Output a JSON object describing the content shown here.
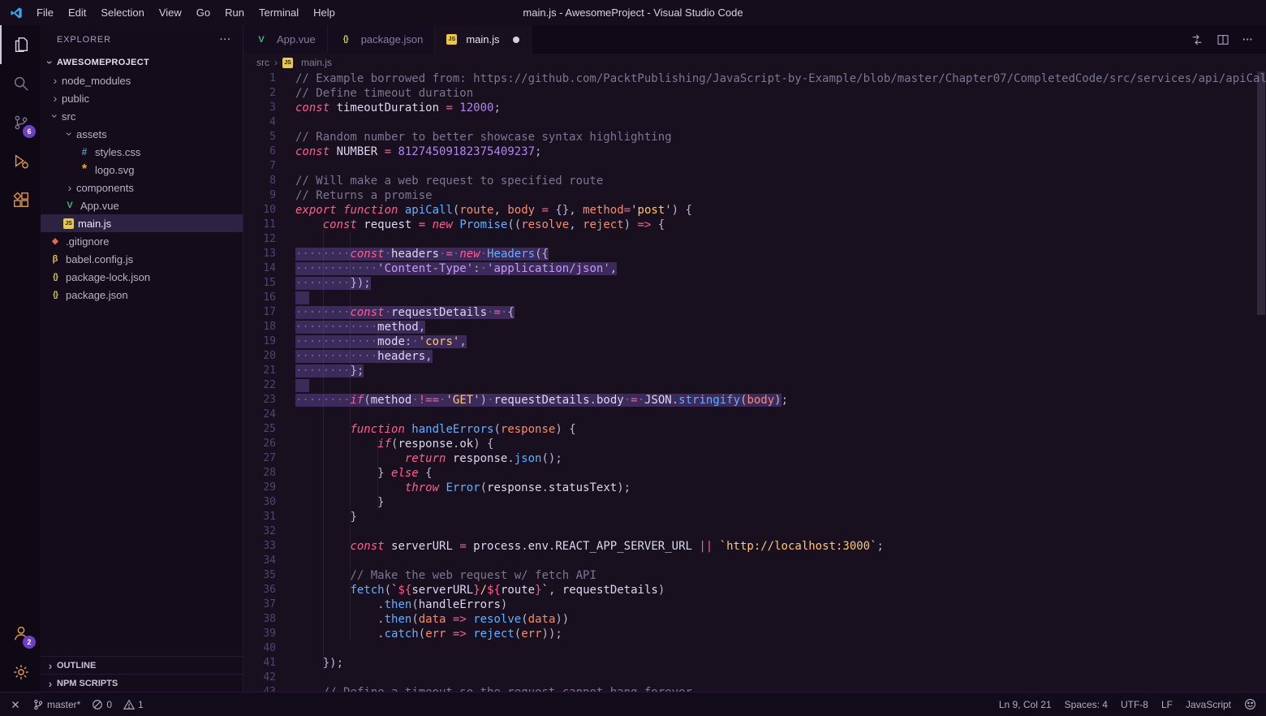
{
  "title_bar": {
    "menus": [
      "File",
      "Edit",
      "Selection",
      "View",
      "Go",
      "Run",
      "Terminal",
      "Help"
    ],
    "title": "main.js - AwesomeProject - Visual Studio Code"
  },
  "activity_bar": {
    "top": [
      {
        "name": "explorer",
        "icon": "files",
        "active": true
      },
      {
        "name": "search",
        "icon": "search"
      },
      {
        "name": "source-control",
        "icon": "scm",
        "badge": "6"
      },
      {
        "name": "run-debug",
        "icon": "debug",
        "amber": true
      },
      {
        "name": "extensions",
        "icon": "extensions",
        "amber": true
      }
    ],
    "bottom": [
      {
        "name": "accounts",
        "icon": "account",
        "badge": "2",
        "amber": true
      },
      {
        "name": "settings",
        "icon": "gear",
        "amber": true
      }
    ]
  },
  "sidebar": {
    "header": "EXPLORER",
    "section": "AWESOMEPROJECT",
    "tree": [
      {
        "label": "node_modules",
        "depth": 0,
        "kind": "folder",
        "expanded": false
      },
      {
        "label": "public",
        "depth": 0,
        "kind": "folder",
        "expanded": false
      },
      {
        "label": "src",
        "depth": 0,
        "kind": "folder",
        "expanded": true
      },
      {
        "label": "assets",
        "depth": 1,
        "kind": "folder",
        "expanded": true
      },
      {
        "label": "styles.css",
        "depth": 2,
        "kind": "file",
        "icon": "css"
      },
      {
        "label": "logo.svg",
        "depth": 2,
        "kind": "file",
        "icon": "svg"
      },
      {
        "label": "components",
        "depth": 1,
        "kind": "folder",
        "expanded": false
      },
      {
        "label": "App.vue",
        "depth": 1,
        "kind": "file",
        "icon": "vue"
      },
      {
        "label": "main.js",
        "depth": 1,
        "kind": "file",
        "icon": "js",
        "selected": true
      },
      {
        "label": ".gitignore",
        "depth": 0,
        "kind": "file",
        "icon": "git"
      },
      {
        "label": "babel.config.js",
        "depth": 0,
        "kind": "file",
        "icon": "babel"
      },
      {
        "label": "package-lock.json",
        "depth": 0,
        "kind": "file",
        "icon": "json"
      },
      {
        "label": "package.json",
        "depth": 0,
        "kind": "file",
        "icon": "json"
      }
    ],
    "bottom_sections": [
      "OUTLINE",
      "NPM SCRIPTS"
    ]
  },
  "tabs": [
    {
      "label": "App.vue",
      "icon": "vue",
      "active": false,
      "modified": false
    },
    {
      "label": "package.json",
      "icon": "json",
      "active": false,
      "modified": false
    },
    {
      "label": "main.js",
      "icon": "js",
      "active": true,
      "modified": true
    }
  ],
  "editor_actions": [
    {
      "name": "open-changes",
      "icon": "compare"
    },
    {
      "name": "split-editor",
      "icon": "split"
    },
    {
      "name": "more-actions",
      "icon": "more"
    }
  ],
  "breadcrumb": [
    {
      "label": "src"
    },
    {
      "label": "main.js",
      "icon": "js"
    }
  ],
  "editor": {
    "lines": [
      [
        [
          "// Example borrowed from: https://github.com/PacktPublishing/JavaScript-by-Example/blob/master/Chapter07/CompletedCode/src/services/api/apiCall.js",
          "c"
        ]
      ],
      [
        [
          "// Define timeout duration",
          "c"
        ]
      ],
      [
        [
          "const ",
          "k"
        ],
        [
          "timeoutDuration ",
          "v"
        ],
        [
          "= ",
          "o"
        ],
        [
          "12000",
          "n"
        ],
        [
          ";",
          "p"
        ]
      ],
      [],
      [
        [
          "// Random number to better showcase syntax highlighting",
          "c"
        ]
      ],
      [
        [
          "const ",
          "k"
        ],
        [
          "NUMBER ",
          "v"
        ],
        [
          "= ",
          "o"
        ],
        [
          "81274509182375409237",
          "n"
        ],
        [
          ";",
          "p"
        ]
      ],
      [],
      [
        [
          "// Will make a web request to specified route",
          "c"
        ]
      ],
      [
        [
          "// Returns a promise",
          "c"
        ]
      ],
      [
        [
          "export ",
          "k"
        ],
        [
          "function ",
          "k"
        ],
        [
          "apiCall",
          "f"
        ],
        [
          "(",
          "p"
        ],
        [
          "route",
          "a"
        ],
        [
          ", ",
          "p"
        ],
        [
          "body ",
          "a"
        ],
        [
          "= ",
          "o"
        ],
        [
          "{}",
          "p"
        ],
        [
          ", ",
          "p"
        ],
        [
          "method",
          "a"
        ],
        [
          "=",
          "o"
        ],
        [
          "'post'",
          "s"
        ],
        [
          ") ",
          "p"
        ],
        [
          "{",
          "p"
        ]
      ],
      [
        [
          "    ",
          "v"
        ],
        [
          "const ",
          "k"
        ],
        [
          "request ",
          "v"
        ],
        [
          "= ",
          "o"
        ],
        [
          "new ",
          "k"
        ],
        [
          "Promise",
          "f"
        ],
        [
          "((",
          "p"
        ],
        [
          "resolve",
          "a"
        ],
        [
          ", ",
          "p"
        ],
        [
          "reject",
          "a"
        ],
        [
          ") ",
          "p"
        ],
        [
          "=> ",
          "o"
        ],
        [
          "{",
          "p"
        ]
      ],
      [],
      [
        [
          "········",
          "w",
          1
        ],
        [
          "const",
          "k",
          1
        ],
        [
          "·",
          "w",
          1
        ],
        [
          "headers",
          "v",
          1
        ],
        [
          "·",
          "w",
          1
        ],
        [
          "=",
          "o",
          1
        ],
        [
          "·",
          "w",
          1
        ],
        [
          "new",
          "k",
          1
        ],
        [
          "·",
          "w",
          1
        ],
        [
          "Headers",
          "f",
          1
        ],
        [
          "({",
          "p",
          1
        ]
      ],
      [
        [
          "············",
          "w",
          1
        ],
        [
          "'Content-Type'",
          "sp",
          1
        ],
        [
          ":",
          "p",
          1
        ],
        [
          "·",
          "w",
          1
        ],
        [
          "'application/json'",
          "sp",
          1
        ],
        [
          ",",
          "p",
          1
        ]
      ],
      [
        [
          "········",
          "w",
          1
        ],
        [
          "});",
          "p",
          1
        ]
      ],
      [
        [
          "  ",
          "v",
          1
        ]
      ],
      [
        [
          "········",
          "w",
          1
        ],
        [
          "const",
          "k",
          1
        ],
        [
          "·",
          "w",
          1
        ],
        [
          "requestDetails",
          "v",
          1
        ],
        [
          "·",
          "w",
          1
        ],
        [
          "=",
          "o",
          1
        ],
        [
          "·",
          "w",
          1
        ],
        [
          "{",
          "p",
          1
        ]
      ],
      [
        [
          "············",
          "w",
          1
        ],
        [
          "method",
          "v",
          1
        ],
        [
          ",",
          "p",
          1
        ]
      ],
      [
        [
          "············",
          "w",
          1
        ],
        [
          "mode",
          "v",
          1
        ],
        [
          ":",
          "p",
          1
        ],
        [
          "·",
          "w",
          1
        ],
        [
          "'cors'",
          "s",
          1
        ],
        [
          ",",
          "p",
          1
        ]
      ],
      [
        [
          "············",
          "w",
          1
        ],
        [
          "headers",
          "v",
          1
        ],
        [
          ",",
          "p",
          1
        ]
      ],
      [
        [
          "········",
          "w",
          1
        ],
        [
          "};",
          "p",
          1
        ]
      ],
      [
        [
          "  ",
          "v",
          1
        ]
      ],
      [
        [
          "········",
          "w",
          1
        ],
        [
          "if",
          "k",
          1
        ],
        [
          "(",
          "p",
          1
        ],
        [
          "method",
          "v",
          1
        ],
        [
          "·",
          "w",
          1
        ],
        [
          "!==",
          "o",
          1
        ],
        [
          "·",
          "w",
          1
        ],
        [
          "'GET'",
          "s",
          1
        ],
        [
          ")",
          "p",
          1
        ],
        [
          "·",
          "w",
          1
        ],
        [
          "requestDetails",
          "v",
          1
        ],
        [
          ".",
          "p",
          1
        ],
        [
          "body",
          "v",
          1
        ],
        [
          "·",
          "w",
          1
        ],
        [
          "=",
          "o",
          1
        ],
        [
          "·",
          "w",
          1
        ],
        [
          "JSON",
          "v",
          1
        ],
        [
          ".",
          "p",
          1
        ],
        [
          "stringify",
          "f",
          1
        ],
        [
          "(",
          "p",
          1
        ],
        [
          "body",
          "a",
          1
        ],
        [
          ")",
          "p",
          1
        ],
        [
          ";",
          "p"
        ]
      ],
      [],
      [
        [
          "        ",
          "v"
        ],
        [
          "function ",
          "k"
        ],
        [
          "handleErrors",
          "f"
        ],
        [
          "(",
          "p"
        ],
        [
          "response",
          "a"
        ],
        [
          ") ",
          "p"
        ],
        [
          "{",
          "p"
        ]
      ],
      [
        [
          "            ",
          "v"
        ],
        [
          "if",
          "k"
        ],
        [
          "(",
          "p"
        ],
        [
          "response",
          "v"
        ],
        [
          ".",
          "p"
        ],
        [
          "ok",
          "v"
        ],
        [
          ") ",
          "p"
        ],
        [
          "{",
          "p"
        ]
      ],
      [
        [
          "                ",
          "v"
        ],
        [
          "return ",
          "k"
        ],
        [
          "response",
          "v"
        ],
        [
          ".",
          "p"
        ],
        [
          "json",
          "f"
        ],
        [
          "();",
          "p"
        ]
      ],
      [
        [
          "            ",
          "v"
        ],
        [
          "} ",
          "p"
        ],
        [
          "else ",
          "k"
        ],
        [
          "{",
          "p"
        ]
      ],
      [
        [
          "                ",
          "v"
        ],
        [
          "throw ",
          "k"
        ],
        [
          "Error",
          "f"
        ],
        [
          "(",
          "p"
        ],
        [
          "response",
          "v"
        ],
        [
          ".",
          "p"
        ],
        [
          "statusText",
          "v"
        ],
        [
          ");",
          "p"
        ]
      ],
      [
        [
          "            ",
          "v"
        ],
        [
          "}",
          "p"
        ]
      ],
      [
        [
          "        ",
          "v"
        ],
        [
          "}",
          "p"
        ]
      ],
      [],
      [
        [
          "        ",
          "v"
        ],
        [
          "const ",
          "k"
        ],
        [
          "serverURL ",
          "v"
        ],
        [
          "= ",
          "o"
        ],
        [
          "process",
          "v"
        ],
        [
          ".",
          "p"
        ],
        [
          "env",
          "v"
        ],
        [
          ".",
          "p"
        ],
        [
          "REACT_APP_SERVER_URL ",
          "v"
        ],
        [
          "|| ",
          "o"
        ],
        [
          "`http://localhost:3000`",
          "s"
        ],
        [
          ";",
          "p"
        ]
      ],
      [],
      [
        [
          "        ",
          "v"
        ],
        [
          "// Make the web request w/ fetch API",
          "c"
        ]
      ],
      [
        [
          "        ",
          "v"
        ],
        [
          "fetch",
          "f"
        ],
        [
          "(",
          "p"
        ],
        [
          "`",
          "s"
        ],
        [
          "${",
          "o"
        ],
        [
          "serverURL",
          "v"
        ],
        [
          "}",
          "o"
        ],
        [
          "/",
          "s"
        ],
        [
          "${",
          "o"
        ],
        [
          "route",
          "v"
        ],
        [
          "}",
          "o"
        ],
        [
          "`",
          "s"
        ],
        [
          ", ",
          "p"
        ],
        [
          "requestDetails",
          "v"
        ],
        [
          ")",
          "p"
        ]
      ],
      [
        [
          "            ",
          "v"
        ],
        [
          ".",
          "p"
        ],
        [
          "then",
          "f"
        ],
        [
          "(",
          "p"
        ],
        [
          "handleErrors",
          "v"
        ],
        [
          ")",
          "p"
        ]
      ],
      [
        [
          "            ",
          "v"
        ],
        [
          ".",
          "p"
        ],
        [
          "then",
          "f"
        ],
        [
          "(",
          "p"
        ],
        [
          "data ",
          "a"
        ],
        [
          "=> ",
          "o"
        ],
        [
          "resolve",
          "f"
        ],
        [
          "(",
          "p"
        ],
        [
          "data",
          "a"
        ],
        [
          "))",
          "p"
        ]
      ],
      [
        [
          "            ",
          "v"
        ],
        [
          ".",
          "p"
        ],
        [
          "catch",
          "f"
        ],
        [
          "(",
          "p"
        ],
        [
          "err ",
          "a"
        ],
        [
          "=> ",
          "o"
        ],
        [
          "reject",
          "f"
        ],
        [
          "(",
          "p"
        ],
        [
          "err",
          "a"
        ],
        [
          "));",
          "p"
        ]
      ],
      [],
      [
        [
          "    ",
          "v"
        ],
        [
          "});",
          "p"
        ]
      ],
      [],
      [
        [
          "    ",
          "v"
        ],
        [
          "// Define a timeout so the request cannot hang forever",
          "c"
        ]
      ]
    ]
  },
  "status_bar": {
    "left": [
      {
        "name": "remote-indicator",
        "icon": "remote"
      },
      {
        "name": "git-branch",
        "icon": "branch",
        "label": "master*"
      },
      {
        "name": "errors",
        "icon": "error",
        "label": "0"
      },
      {
        "name": "warnings",
        "icon": "warning",
        "label": "1"
      }
    ],
    "right": [
      {
        "name": "cursor-position",
        "label": "Ln 9, Col 21"
      },
      {
        "name": "indentation",
        "label": "Spaces: 4"
      },
      {
        "name": "encoding",
        "label": "UTF-8"
      },
      {
        "name": "eol",
        "label": "LF"
      },
      {
        "name": "language-mode",
        "label": "JavaScript"
      },
      {
        "name": "feedback",
        "icon": "smiley"
      }
    ]
  }
}
